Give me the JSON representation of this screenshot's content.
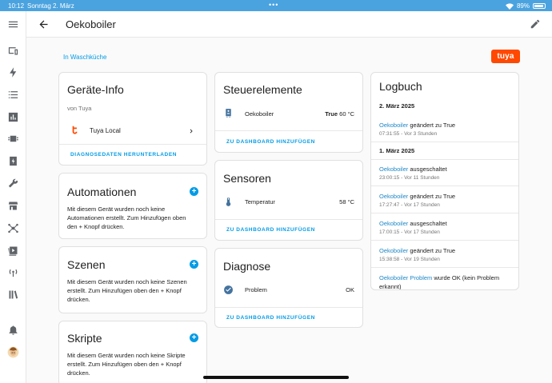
{
  "status": {
    "time": "10:12",
    "date": "Sonntag 2. März",
    "dots": "•••",
    "battery": "89%"
  },
  "header": {
    "title": "Oekoboiler",
    "back_icon": "arrow-left-icon",
    "edit_icon": "pencil-icon"
  },
  "area_link": "In Waschküche",
  "brand_logo": "tuya",
  "sidebar": {
    "items": [
      {
        "icon": "menu-icon"
      },
      {
        "icon": "devices-icon"
      },
      {
        "icon": "lightning-icon"
      },
      {
        "icon": "list-icon"
      },
      {
        "icon": "chart-icon"
      },
      {
        "icon": "chip-icon"
      },
      {
        "icon": "energy-icon"
      },
      {
        "icon": "wrench-icon"
      },
      {
        "icon": "store-icon"
      },
      {
        "icon": "network-icon"
      },
      {
        "icon": "media-icon"
      },
      {
        "icon": "broadcast-icon"
      },
      {
        "icon": "library-icon"
      },
      {
        "icon": "bell-icon"
      },
      {
        "icon": "avatar-icon"
      }
    ]
  },
  "device_info": {
    "title": "Geräte-Info",
    "by": "von Tuya",
    "integration": "Tuya Local",
    "action": "DIAGNOSEDATEN HERUNTERLADEN"
  },
  "automations": {
    "title": "Automationen",
    "text": "Mit diesem Gerät wurden noch keine Automationen erstellt. Zum Hinzufügen oben den + Knopf drücken."
  },
  "scenes": {
    "title": "Szenen",
    "text": "Mit diesem Gerät wurden noch keine Szenen erstellt. Zum Hinzufügen oben den + Knopf drücken."
  },
  "scripts": {
    "title": "Skripte",
    "text": "Mit diesem Gerät wurden noch keine Skripte erstellt. Zum Hinzufügen oben den + Knopf drücken."
  },
  "controls": {
    "title": "Steuerelemente",
    "row_label": "Oekoboiler",
    "row_value_bold": "True",
    "row_value": "60 °C",
    "action": "ZU DASHBOARD HINZUFÜGEN"
  },
  "sensors": {
    "title": "Sensoren",
    "row_label": "Temperatur",
    "row_value": "58 °C",
    "action": "ZU DASHBOARD HINZUFÜGEN"
  },
  "diagnostics": {
    "title": "Diagnose",
    "row_label": "Problem",
    "row_value": "OK",
    "action": "ZU DASHBOARD HINZUFÜGEN"
  },
  "logbook": {
    "title": "Logbuch",
    "groups": [
      {
        "date": "2. März 2025"
      },
      {
        "date": "1. März 2025"
      }
    ],
    "entries": [
      {
        "entity": "Oekoboiler",
        "message": " geändert zu True",
        "time": "07:31:55 - Vor 3 Stunden"
      },
      {
        "entity": "Oekoboiler",
        "message": " ausgeschaltet",
        "time": "23:00:15 - Vor 11 Stunden"
      },
      {
        "entity": "Oekoboiler",
        "message": " geändert zu True",
        "time": "17:27:47 - Vor 17 Stunden"
      },
      {
        "entity": "Oekoboiler",
        "message": " ausgeschaltet",
        "time": "17:00:15 - Vor 17 Stunden"
      },
      {
        "entity": "Oekoboiler",
        "message": " geändert zu True",
        "time": "15:38:58 - Vor 19 Stunden"
      },
      {
        "entity": "Oekoboiler Problem",
        "message": " wurde OK (kein Problem erkannt)",
        "time": ""
      }
    ]
  }
}
